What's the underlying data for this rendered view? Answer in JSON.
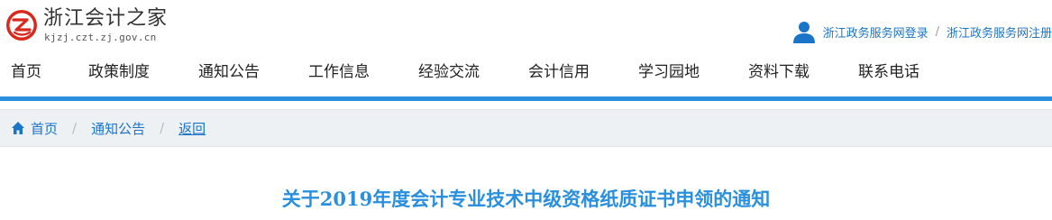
{
  "header": {
    "site_name": "浙江会计之家",
    "site_domain": "kjzj.czt.zj.gov.cn",
    "logo_icon": "site-logo",
    "user_icon": "user-icon",
    "login_link": "浙江政务服务网登录",
    "separator": "/",
    "register_link": "浙江政务服务网注册"
  },
  "nav": {
    "items": [
      {
        "label": "首页"
      },
      {
        "label": "政策制度"
      },
      {
        "label": "通知公告"
      },
      {
        "label": "工作信息"
      },
      {
        "label": "经验交流"
      },
      {
        "label": "会计信用"
      },
      {
        "label": "学习园地"
      },
      {
        "label": "资料下载"
      },
      {
        "label": "联系电话"
      }
    ]
  },
  "breadcrumb": {
    "home_icon": "home-icon",
    "items": [
      {
        "label": "首页"
      },
      {
        "label": "通知公告"
      },
      {
        "label": "返回"
      }
    ],
    "separator": "/"
  },
  "article": {
    "title": "关于2019年度会计专业技术中级资格纸质证书申领的通知"
  },
  "colors": {
    "accent": "#2a8fdc",
    "link": "#1a74c7",
    "logo_red": "#d9291c",
    "breadcrumb_bg": "#eef1f4"
  }
}
